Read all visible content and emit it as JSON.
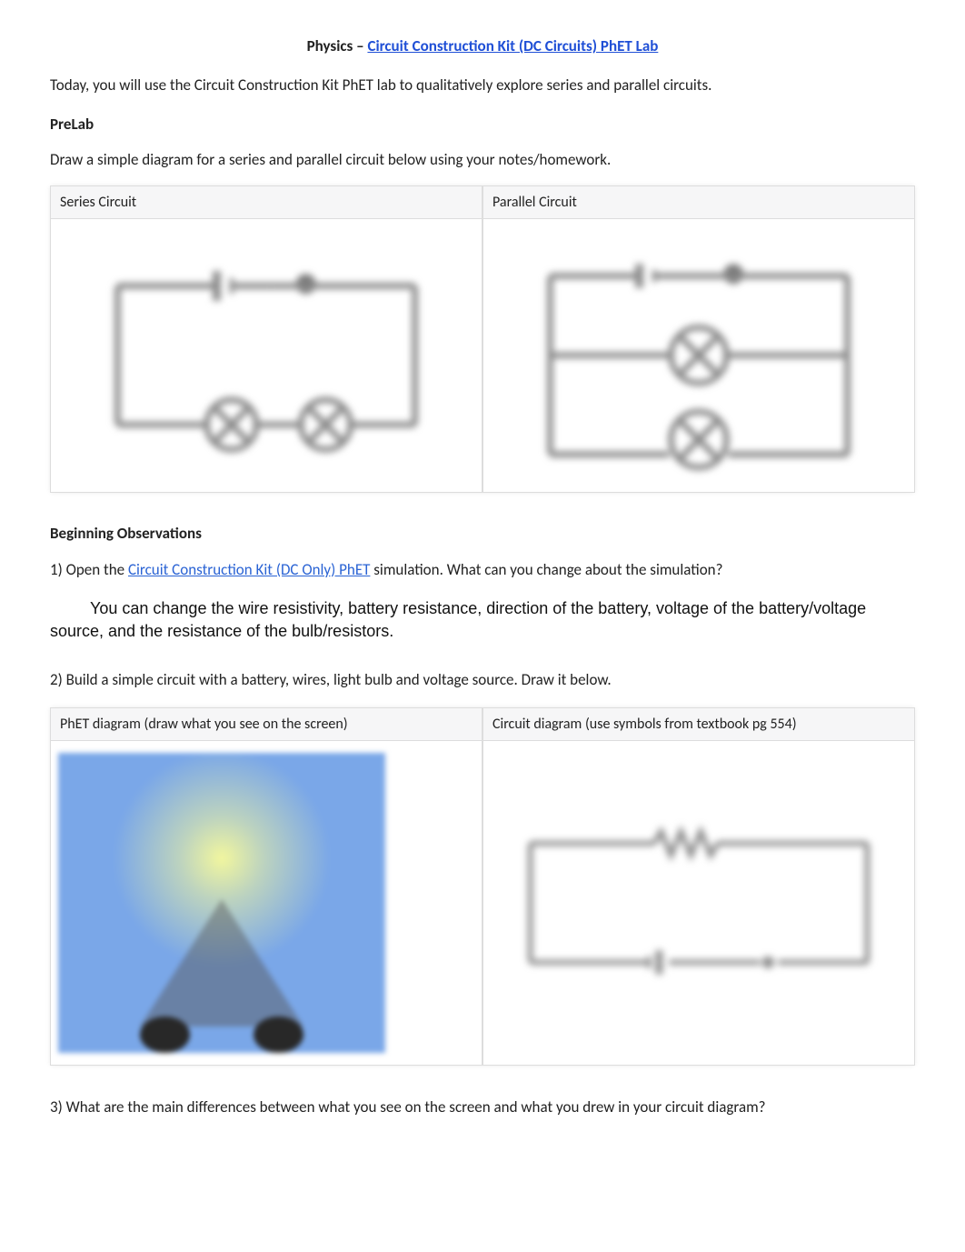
{
  "title": {
    "prefix": "Physics – ",
    "link": "Circuit Construction Kit (DC Circuits) PhET Lab"
  },
  "intro": "Today, you will use the Circuit Construction Kit PhET lab to qualitatively explore series and parallel circuits.",
  "prelab": {
    "header": "PreLab",
    "instruction": "Draw a simple diagram for a series and parallel circuit below using your notes/homework.",
    "series_label": "Series Circuit",
    "parallel_label": "Parallel Circuit"
  },
  "observations": {
    "header": "Beginning Observations",
    "q1_prefix": "1) Open the ",
    "q1_link": "Circuit Construction Kit (DC Only) PhET",
    "q1_suffix": " simulation. What can you change about the simulation?",
    "a1": "You can change the wire resistivity, battery resistance, direction of the battery, voltage of the battery/voltage source, and the resistance of the bulb/resistors.",
    "q2": "2) Build a simple circuit with a battery, wires, light bulb and voltage source. Draw it below.",
    "phet_diagram_label": "PhET diagram (draw what you see on the screen)",
    "circuit_diagram_label": "Circuit diagram (use symbols from textbook pg 554)",
    "q3": "3) What are the main differences between what you see on the screen and what you drew in your circuit diagram?"
  }
}
